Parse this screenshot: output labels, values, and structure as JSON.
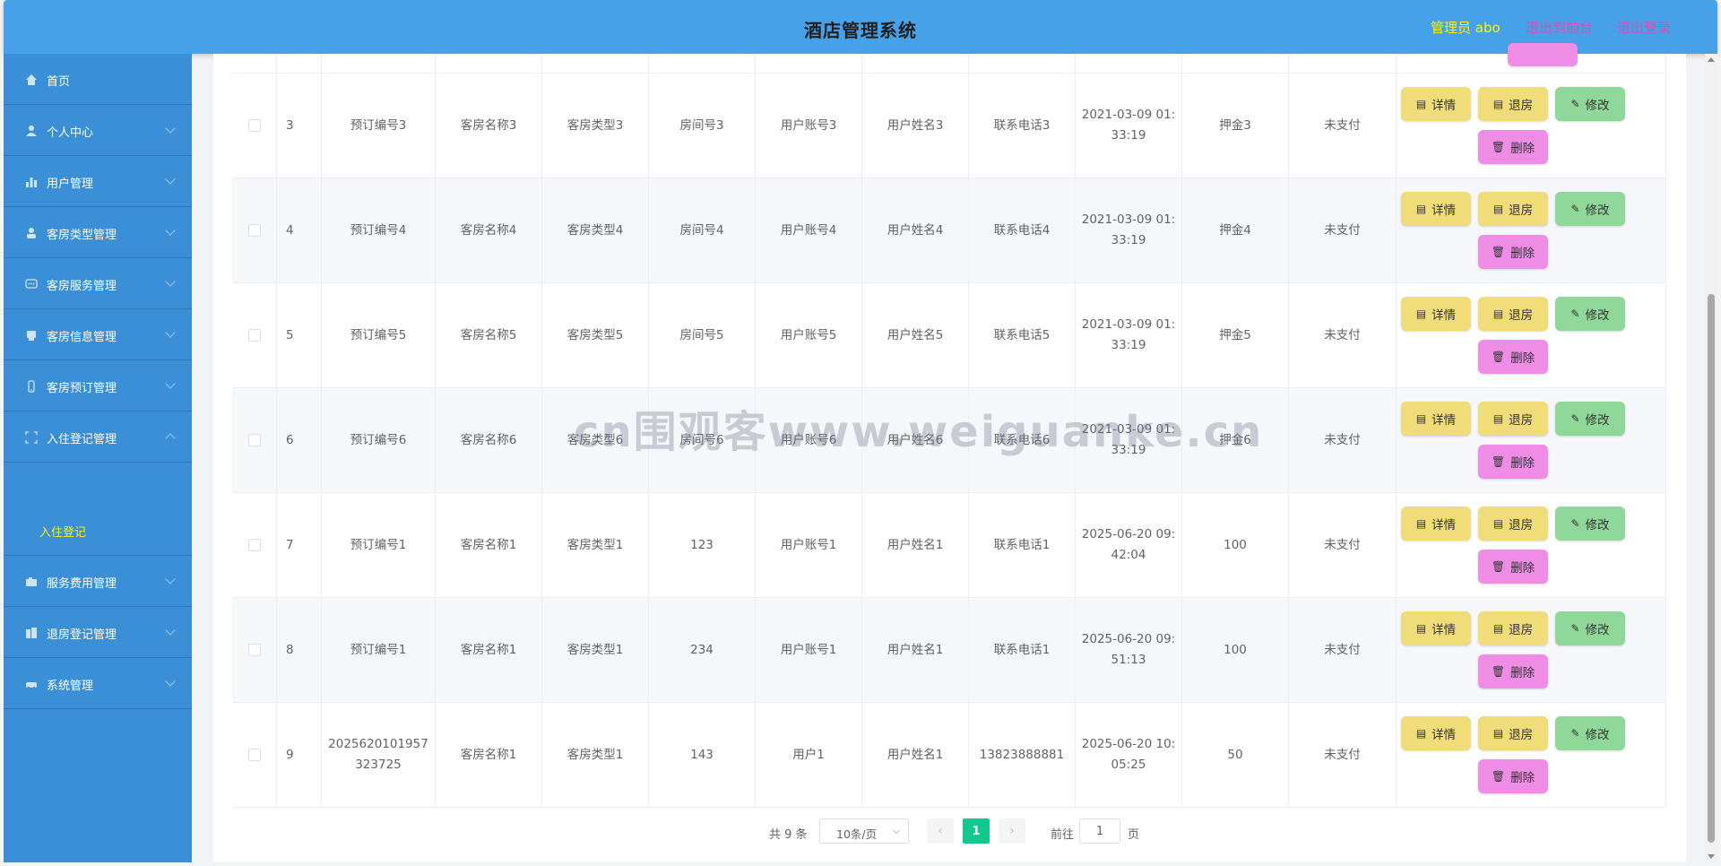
{
  "header": {
    "title": "酒店管理系统",
    "admin_label": "管理员 abo",
    "front_link": "退出到前台",
    "logout_link": "退出登录"
  },
  "sidebar": {
    "items": [
      {
        "label": "首页",
        "icon": "home-icon"
      },
      {
        "label": "个人中心",
        "icon": "user-icon"
      },
      {
        "label": "用户管理",
        "icon": "bar-chart-icon"
      },
      {
        "label": "客房类型管理",
        "icon": "person-icon"
      },
      {
        "label": "客房服务管理",
        "icon": "chat-icon"
      },
      {
        "label": "客房信息管理",
        "icon": "box-icon"
      },
      {
        "label": "客房预订管理",
        "icon": "phone-icon"
      },
      {
        "label": "入住登记管理",
        "icon": "fullscreen-icon"
      },
      {
        "label": "服务费用管理",
        "icon": "camera-icon"
      },
      {
        "label": "退房登记管理",
        "icon": "building-icon"
      },
      {
        "label": "系统管理",
        "icon": "car-icon"
      }
    ],
    "active_sub": "入住登记"
  },
  "buttons": {
    "detail": "详情",
    "checkout": "退房",
    "edit": "修改",
    "delete": "删除"
  },
  "table": {
    "rows": [
      {
        "idx": "3",
        "booking_no": "预订编号3",
        "room_name": "客房名称3",
        "room_type": "客房类型3",
        "room_no": "房间号3",
        "account": "用户账号3",
        "user_name": "用户姓名3",
        "phone": "联系电话3",
        "time": "2021-03-09 01:33:19",
        "deposit": "押金3",
        "pay": "未支付"
      },
      {
        "idx": "4",
        "booking_no": "预订编号4",
        "room_name": "客房名称4",
        "room_type": "客房类型4",
        "room_no": "房间号4",
        "account": "用户账号4",
        "user_name": "用户姓名4",
        "phone": "联系电话4",
        "time": "2021-03-09 01:33:19",
        "deposit": "押金4",
        "pay": "未支付"
      },
      {
        "idx": "5",
        "booking_no": "预订编号5",
        "room_name": "客房名称5",
        "room_type": "客房类型5",
        "room_no": "房间号5",
        "account": "用户账号5",
        "user_name": "用户姓名5",
        "phone": "联系电话5",
        "time": "2021-03-09 01:33:19",
        "deposit": "押金5",
        "pay": "未支付"
      },
      {
        "idx": "6",
        "booking_no": "预订编号6",
        "room_name": "客房名称6",
        "room_type": "客房类型6",
        "room_no": "房间号6",
        "account": "用户账号6",
        "user_name": "用户姓名6",
        "phone": "联系电话6",
        "time": "2021-03-09 01:33:19",
        "deposit": "押金6",
        "pay": "未支付"
      },
      {
        "idx": "7",
        "booking_no": "预订编号1",
        "room_name": "客房名称1",
        "room_type": "客房类型1",
        "room_no": "123",
        "account": "用户账号1",
        "user_name": "用户姓名1",
        "phone": "联系电话1",
        "time": "2025-06-20 09:42:04",
        "deposit": "100",
        "pay": "未支付"
      },
      {
        "idx": "8",
        "booking_no": "预订编号1",
        "room_name": "客房名称1",
        "room_type": "客房类型1",
        "room_no": "234",
        "account": "用户账号1",
        "user_name": "用户姓名1",
        "phone": "联系电话1",
        "time": "2025-06-20 09:51:13",
        "deposit": "100",
        "pay": "未支付"
      },
      {
        "idx": "9",
        "booking_no": "2025620101957323725",
        "room_name": "客房名称1",
        "room_type": "客房类型1",
        "room_no": "143",
        "account": "用户1",
        "user_name": "用户姓名1",
        "phone": "13823888881",
        "time": "2025-06-20 10:05:25",
        "deposit": "50",
        "pay": "未支付"
      }
    ]
  },
  "pagination": {
    "total": "共 9 条",
    "page_size": "10条/页",
    "prev": "‹",
    "current": "1",
    "next": "›",
    "goto_label": "前往",
    "goto_value": "1",
    "page_suffix": "页"
  },
  "watermark": "cn围观客www.weiguanke.cn",
  "colors": {
    "header_bg": "#46a1e8",
    "sidebar_bg": "#3a8fd6",
    "admin_text": "#fff200",
    "link_text": "#d84eb8",
    "active_page": "#13c78d"
  }
}
